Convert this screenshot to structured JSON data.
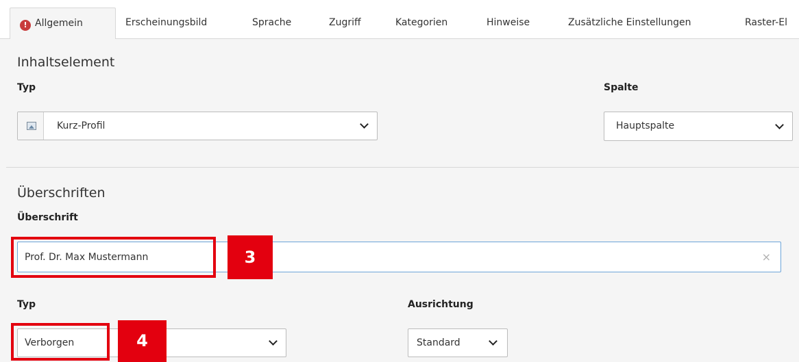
{
  "tabs": [
    {
      "label": "Allgemein",
      "active": true,
      "icon": "alert-icon"
    },
    {
      "label": "Erscheinungsbild"
    },
    {
      "label": "Sprache"
    },
    {
      "label": "Zugriff"
    },
    {
      "label": "Kategorien"
    },
    {
      "label": "Hinweise"
    },
    {
      "label": "Zusätzliche Einstellungen"
    },
    {
      "label": "Raster-El"
    }
  ],
  "content_element": {
    "section_title": "Inhaltselement",
    "type_label": "Typ",
    "type_value": "Kurz-Profil",
    "column_label": "Spalte",
    "column_value": "Hauptspalte"
  },
  "headings": {
    "section_title": "Überschriften",
    "heading_label": "Überschrift",
    "heading_value": "Prof. Dr. Max Mustermann",
    "clear_symbol": "×",
    "type_label": "Typ",
    "type_value": "Verborgen",
    "alignment_label": "Ausrichtung",
    "alignment_value": "Standard"
  },
  "annotations": {
    "marker_3": "3",
    "marker_4": "4",
    "color": "#e3000f"
  },
  "colors": {
    "alert": "#c83c3c",
    "focus_border": "#6ca4d8",
    "background": "#f5f5f5"
  }
}
